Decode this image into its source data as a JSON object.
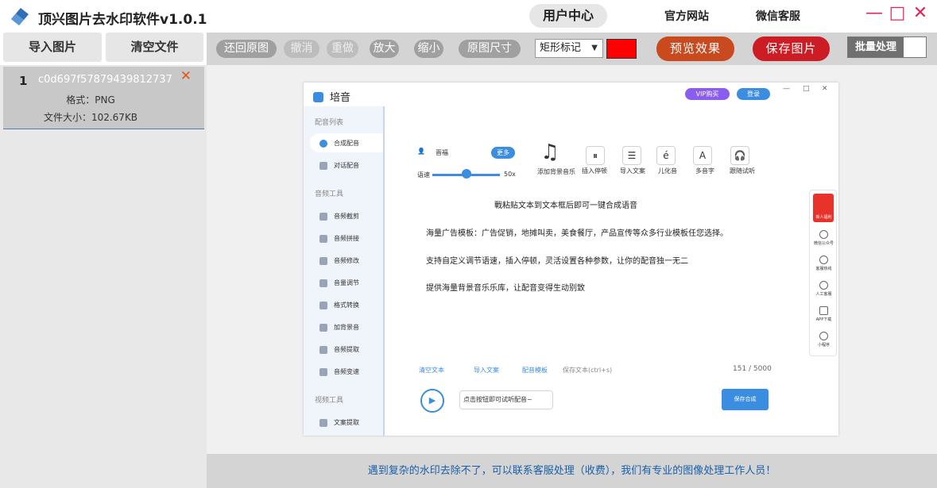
{
  "app": {
    "title": "顶兴图片去水印软件v1.0.1",
    "user_center": "用户中心",
    "links": [
      "官方网站",
      "微信客服"
    ]
  },
  "left_buttons": [
    "导入图片",
    "清空文件"
  ],
  "toolbar": {
    "restore": "还回原图",
    "undo": "撤消",
    "redo": "重做",
    "zoom_in": "放大",
    "zoom_out": "缩小",
    "original_size": "原图尺寸",
    "mark_mode": "矩形标记",
    "mark_color": "#ff0000",
    "preview": "预览效果",
    "save": "保存图片",
    "batch": "批量处理"
  },
  "files": [
    {
      "index": "1",
      "name": "c0d697f57879439812737",
      "format": "格式：PNG",
      "size": "文件大小：102.67KB"
    }
  ],
  "footer": "遇到复杂的水印去除不了，可以联系客服处理（收费），我们有专业的图像处理工作人员！",
  "shot": {
    "app_name": "培音",
    "vip": "VIP购买",
    "login": "登录",
    "sidebar": {
      "dub_head": "配音列表",
      "dub_items": [
        "合成配音",
        "对话配音"
      ],
      "audio_head": "音频工具",
      "audio_items": [
        "音频截剪",
        "音频拼接",
        "音频修改",
        "音量调节",
        "格式转换",
        "加背景音",
        "音频提取",
        "音频变速"
      ],
      "video_head": "视频工具",
      "video_items": [
        "文案提取"
      ]
    },
    "voice_name": "晋福",
    "more": "更多",
    "speed_label": "语速",
    "speed_value": "50x",
    "tools": [
      "添加背景音乐",
      "插入停顿",
      "导入文案",
      "儿化音",
      "多音字",
      "跟随试听"
    ],
    "lines": [
      "戰粘贴文本到文本框后即可一键合成语音",
      "海量广告模板：广告促销，地摊叫卖，美食餐厅，产品宣传等众多行业模板任您选择。",
      "支持自定义调节语速，插入停顿，灵活设置各种参数，让你的配音独一无二",
      "提供海量背景音乐乐库，让配音变得生动别致"
    ],
    "bottom_links": [
      "清空文本",
      "导入文案",
      "配音模板",
      "保存文本(ctrl+s)"
    ],
    "count": "151 / 5000",
    "play_hint": "点击按钮即可试听配音~",
    "save_btn": "保存合成",
    "float": [
      "新人福利",
      "微信公众号",
      "客服热线",
      "人工客服",
      "APP下载",
      "小程序"
    ]
  }
}
